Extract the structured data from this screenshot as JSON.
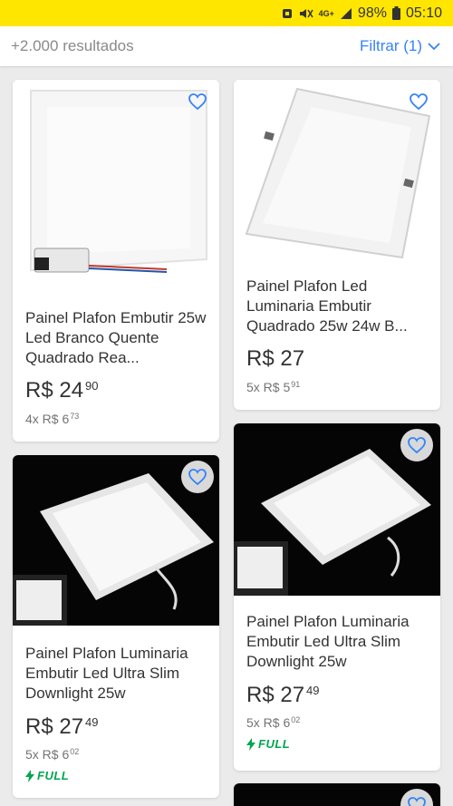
{
  "status_bar": {
    "network": "4G+",
    "battery": "98%",
    "time": "05:10"
  },
  "header": {
    "results_count": "+2.000 resultados",
    "filter_label": "Filtrar (1)"
  },
  "products": [
    {
      "title": "Painel Plafon Embutir 25w Led Branco Quente Quadrado Rea...",
      "price": "R$ 24",
      "price_cents": "90",
      "installments": "4x R$ 6",
      "installments_cents": "73",
      "full": ""
    },
    {
      "title": "Painel Plafon Led Luminaria Embutir Quadrado 25w 24w B...",
      "price": "R$ 27",
      "price_cents": "",
      "installments": "5x R$ 5",
      "installments_cents": "91",
      "full": ""
    },
    {
      "title": "Painel Plafon Luminaria Embutir Led Ultra Slim Downlight 25w",
      "price": "R$ 27",
      "price_cents": "49",
      "installments": "5x R$ 6",
      "installments_cents": "02",
      "full": "FULL"
    },
    {
      "title": "Painel Plafon Luminaria Embutir Led Ultra Slim Downlight 25w",
      "price": "R$ 27",
      "price_cents": "49",
      "installments": "5x R$ 6",
      "installments_cents": "02",
      "full": "FULL"
    }
  ],
  "colors": {
    "brand_yellow": "#ffe600",
    "link_blue": "#3483fa",
    "full_green": "#00a650"
  }
}
